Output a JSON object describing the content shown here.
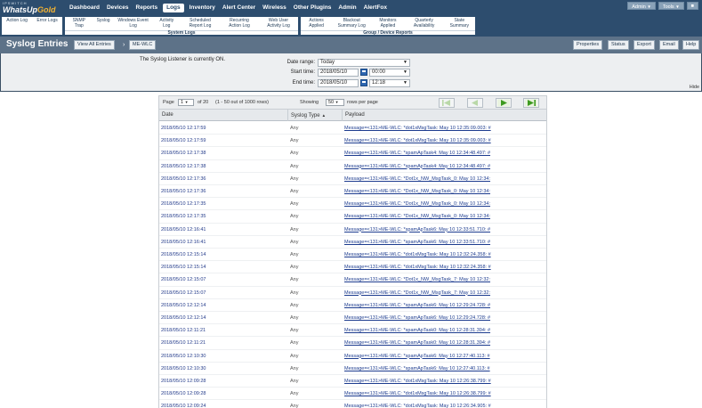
{
  "app": {
    "logo_top": "IPSWITCH",
    "logo_main": "WhatsUp",
    "logo_gold": "Gold"
  },
  "nav": {
    "items": [
      "Dashboard",
      "Devices",
      "Reports",
      "Logs",
      "Inventory",
      "Alert Center",
      "Wireless",
      "Other Plugins",
      "Admin",
      "AlertFox"
    ],
    "active": "Logs"
  },
  "user_menu": {
    "user": "Admin",
    "tools": "Tools"
  },
  "subnav": {
    "groups": [
      {
        "items": [
          "Action Log",
          "Error Logs"
        ],
        "caption": ""
      },
      {
        "items": [
          "SNMP Trap",
          "Syslog",
          "Windows Event Log",
          "Activity Log",
          "Scheduled Report Log",
          "Recurring Action Log",
          "Web User Activity Log"
        ],
        "caption": "System Logs"
      },
      {
        "items": [
          "Actions Applied",
          "Blackout Summary Log",
          "Monitors Applied",
          "Quarterly Availability",
          "State Summary"
        ],
        "caption": "Group / Device Reports"
      }
    ]
  },
  "title_bar": {
    "title": "Syslog Entries",
    "view_all": "View All Entries",
    "device": "ME-WLC",
    "separator": "›",
    "buttons": [
      "Properties",
      "Status",
      "Export",
      "Email",
      "Help"
    ]
  },
  "filter": {
    "listener_text": "The Syslog Listener is currently ON.",
    "date_range_label": "Date range:",
    "date_range_value": "Today",
    "start_label": "Start time:",
    "start_date": "2018/05/10",
    "start_time": "00:00",
    "end_label": "End time:",
    "end_date": "2018/05/10",
    "end_time": "12:18",
    "hide_label": "Hide"
  },
  "pager": {
    "page_label": "Page",
    "page_value": "1",
    "of_text": "of 20",
    "rows_info": "(1 - 50 out of 1000 rows)",
    "showing_label": "Showing",
    "per_page_value": "50",
    "per_page_label": "rows per page"
  },
  "table": {
    "headers": [
      "Date",
      "Syslog Type",
      "Payload"
    ],
    "sort_indicator": "▲",
    "rows": [
      {
        "date": "2018/05/10 12:17:59",
        "type": "Any",
        "payload": "Message=<131>ME-WLC: *dot1xMsgTask: May 10 12:35:09.003: #"
      },
      {
        "date": "2018/05/10 12:17:59",
        "type": "Any",
        "payload": "Message=<131>ME-WLC: *dot1xMsgTask: May 10 12:35:09.003: #"
      },
      {
        "date": "2018/05/10 12:17:38",
        "type": "Any",
        "payload": "Message=<131>ME-WLC: *spamApTask4: May 10 12:34:48.497: #"
      },
      {
        "date": "2018/05/10 12:17:38",
        "type": "Any",
        "payload": "Message=<131>ME-WLC: *spamApTask4: May 10 12:34:48.497: #"
      },
      {
        "date": "2018/05/10 12:17:36",
        "type": "Any",
        "payload": "Message=<131>ME-WLC: *Dot1x_NW_MsgTask_0: May 10 12:34:"
      },
      {
        "date": "2018/05/10 12:17:36",
        "type": "Any",
        "payload": "Message=<131>ME-WLC: *Dot1x_NW_MsgTask_0: May 10 12:34:"
      },
      {
        "date": "2018/05/10 12:17:35",
        "type": "Any",
        "payload": "Message=<131>ME-WLC: *Dot1x_NW_MsgTask_0: May 10 12:34:"
      },
      {
        "date": "2018/05/10 12:17:35",
        "type": "Any",
        "payload": "Message=<131>ME-WLC: *Dot1x_NW_MsgTask_0: May 10 12:34:"
      },
      {
        "date": "2018/05/10 12:16:41",
        "type": "Any",
        "payload": "Message=<131>ME-WLC: *spamApTask6: May 10 12:33:51.710: #"
      },
      {
        "date": "2018/05/10 12:16:41",
        "type": "Any",
        "payload": "Message=<131>ME-WLC: *spamApTask6: May 10 12:33:51.710: #"
      },
      {
        "date": "2018/05/10 12:15:14",
        "type": "Any",
        "payload": "Message=<131>ME-WLC: *dot1xMsgTask: May 10 12:32:24.358: #"
      },
      {
        "date": "2018/05/10 12:15:14",
        "type": "Any",
        "payload": "Message=<131>ME-WLC: *dot1xMsgTask: May 10 12:32:24.358: #"
      },
      {
        "date": "2018/05/10 12:15:07",
        "type": "Any",
        "payload": "Message=<131>ME-WLC: *Dot1x_NW_MsgTask_7: May 10 12:32:"
      },
      {
        "date": "2018/05/10 12:15:07",
        "type": "Any",
        "payload": "Message=<131>ME-WLC: *Dot1x_NW_MsgTask_7: May 10 12:32:"
      },
      {
        "date": "2018/05/10 12:12:14",
        "type": "Any",
        "payload": "Message=<131>ME-WLC: *spamApTask6: May 10 12:29:24.728: #"
      },
      {
        "date": "2018/05/10 12:12:14",
        "type": "Any",
        "payload": "Message=<131>ME-WLC: *spamApTask6: May 10 12:29:24.728: #"
      },
      {
        "date": "2018/05/10 12:11:21",
        "type": "Any",
        "payload": "Message=<131>ME-WLC: *spamApTask0: May 10 12:28:31.394: #"
      },
      {
        "date": "2018/05/10 12:11:21",
        "type": "Any",
        "payload": "Message=<131>ME-WLC: *spamApTask0: May 10 12:28:31.394: #"
      },
      {
        "date": "2018/05/10 12:10:30",
        "type": "Any",
        "payload": "Message=<131>ME-WLC: *spamApTask6: May 10 12:27:40.113: #"
      },
      {
        "date": "2018/05/10 12:10:30",
        "type": "Any",
        "payload": "Message=<131>ME-WLC: *spamApTask6: May 10 12:27:40.113: #"
      },
      {
        "date": "2018/05/10 12:09:28",
        "type": "Any",
        "payload": "Message=<131>ME-WLC: *dot1xMsgTask: May 10 12:26:38.799: #"
      },
      {
        "date": "2018/05/10 12:09:28",
        "type": "Any",
        "payload": "Message=<131>ME-WLC: *dot1xMsgTask: May 10 12:26:38.799: #"
      },
      {
        "date": "2018/05/10 12:09:24",
        "type": "Any",
        "payload": "Message=<131>ME-WLC: *dot1xMsgTask: May 10 12:26:34.905: #"
      }
    ]
  },
  "colors": {
    "header_bg": "#2d4d6e",
    "titlebar_bg": "#5d7288",
    "link": "#1d3c8f",
    "pager_green": "#3d9a1f"
  }
}
